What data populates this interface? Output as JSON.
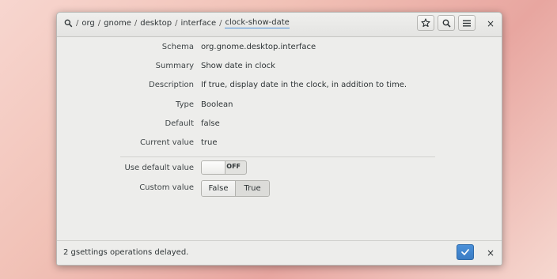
{
  "path": {
    "icon": "search-folder-icon",
    "segments": [
      "org",
      "gnome",
      "desktop",
      "interface",
      "clock-show-date"
    ],
    "separator": "/"
  },
  "header_buttons": {
    "bookmark_icon": "star-icon",
    "search_icon": "search-icon",
    "menu_icon": "hamburger-menu-icon",
    "close": "×"
  },
  "details": {
    "schema_label": "Schema",
    "schema_value": "org.gnome.desktop.interface",
    "summary_label": "Summary",
    "summary_value": "Show date in clock",
    "description_label": "Description",
    "description_value": "If true, display date in the clock, in addition to time.",
    "type_label": "Type",
    "type_value": "Boolean",
    "default_label": "Default",
    "default_value": "false",
    "current_label": "Current value",
    "current_value": "true"
  },
  "controls": {
    "use_default_label": "Use default value",
    "use_default_state": "OFF",
    "custom_label": "Custom value",
    "custom_options": [
      "False",
      "True"
    ],
    "custom_selected": "True"
  },
  "footer": {
    "message": "2 gsettings operations delayed.",
    "apply_icon": "checkmark-icon",
    "dismiss": "×"
  },
  "colors": {
    "accent": "#4a90d9",
    "window_bg": "#ededeb"
  }
}
